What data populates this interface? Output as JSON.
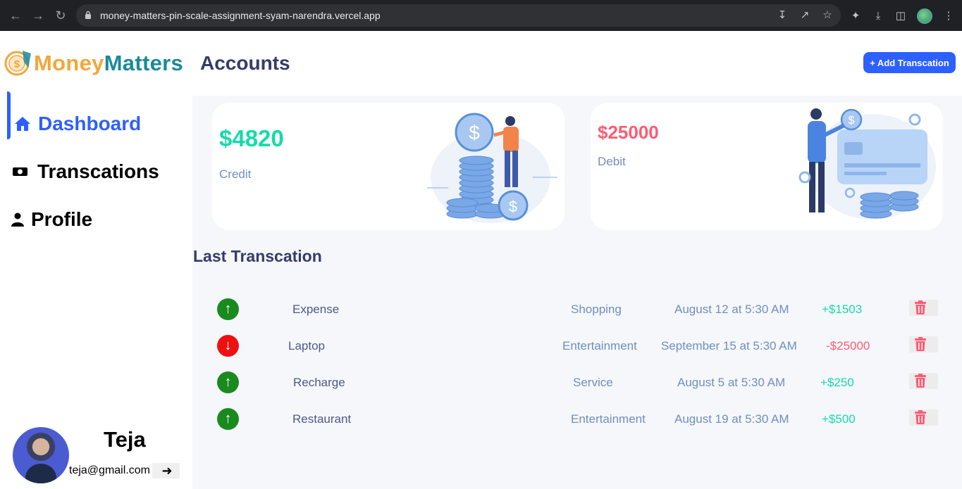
{
  "browser": {
    "url": "money-matters-pin-scale-assignment-syam-narendra.vercel.app"
  },
  "header": {
    "logo_part1": "Money",
    "logo_part2": "Matters",
    "page_title": "Accounts",
    "add_button_label": "+ Add Transcation"
  },
  "sidebar": {
    "items": [
      {
        "label": "Dashboard",
        "icon": "home-icon",
        "active": true
      },
      {
        "label": "Transcations",
        "icon": "money-icon",
        "active": false
      },
      {
        "label": "Profile",
        "icon": "user-icon",
        "active": false
      }
    ],
    "user": {
      "name": "Teja",
      "email": "teja@gmail.com"
    }
  },
  "cards": {
    "credit": {
      "amount": "$4820",
      "label": "Credit",
      "color": "#16dbaa"
    },
    "debit": {
      "amount": "$25000",
      "label": "Debit",
      "color": "#fe5c73"
    }
  },
  "transactions": {
    "title": "Last Transcation",
    "rows": [
      {
        "direction": "up",
        "name": "Expense",
        "category": "Shopping",
        "date": "August 12 at 5:30 AM",
        "amount": "+$1503"
      },
      {
        "direction": "down",
        "name": "Laptop",
        "category": "Entertainment",
        "date": "September 15 at 5:30 AM",
        "amount": "-$25000"
      },
      {
        "direction": "up",
        "name": "Recharge",
        "category": "Service",
        "date": "August 5 at 5:30 AM",
        "amount": "+$250"
      },
      {
        "direction": "up",
        "name": "Restaurant",
        "category": "Entertainment",
        "date": "August 19 at 5:30 AM",
        "amount": "+$500"
      }
    ]
  },
  "colors": {
    "accent": "#2d60ff",
    "credit": "#16dbaa",
    "debit": "#fe5c73",
    "title": "#343c6a"
  }
}
